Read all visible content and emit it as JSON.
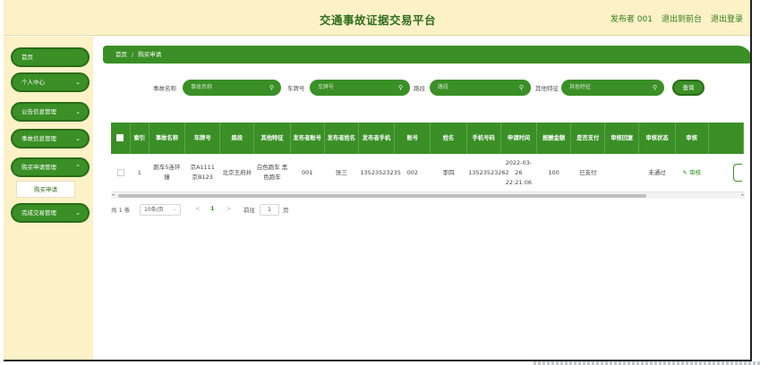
{
  "header": {
    "title": "交通事故证据交易平台",
    "user": "发布者 001",
    "exit_front": "退出到前台",
    "logout": "退出登录"
  },
  "sidebar": {
    "items": [
      {
        "label": "首页",
        "has_chevron": false
      },
      {
        "label": "个人中心",
        "has_chevron": true
      },
      {
        "label": "公告信息管理",
        "has_chevron": true
      },
      {
        "label": "事故信息管理",
        "has_chevron": true
      },
      {
        "label": "购买申请管理",
        "has_chevron": true
      },
      {
        "label": "完成交易管理",
        "has_chevron": true
      }
    ],
    "submenu_active": "购买申请",
    "chevron_icon": "chevron-down-icon"
  },
  "breadcrumb": {
    "home": "首页",
    "separator": "/",
    "current": "购买申请"
  },
  "search": {
    "fields": [
      {
        "label": "事故名称",
        "placeholder": "事故名称"
      },
      {
        "label": "车牌号",
        "placeholder": "车牌号"
      },
      {
        "label": "路段",
        "placeholder": "路段"
      },
      {
        "label": "其他特征",
        "placeholder": "其他特征"
      }
    ],
    "search_icon": "search-icon",
    "query_button": "查询"
  },
  "table": {
    "headers": [
      "",
      "索引",
      "事故名称",
      "车牌号",
      "路段",
      "其他特征",
      "发布者账号",
      "发布者姓名",
      "发布者手机",
      "账号",
      "姓名",
      "手机号码",
      "申请时间",
      "报酬金额",
      "是否支付",
      "审核回复",
      "审核状态",
      "审核",
      ""
    ],
    "rows": [
      {
        "index": "1",
        "accident_name": "跑车5连环撞",
        "plate": "京A1111 京B123",
        "road": "北京王府井",
        "feature": "白色跑车 黑色跑车",
        "publisher_account": "001",
        "publisher_name": "张三",
        "publisher_phone": "13523523235",
        "account": "002",
        "name": "李四",
        "phone": "13523523262",
        "apply_time": "2022-03-26 22:21:06",
        "amount": "100",
        "paid": "已支付",
        "reply": "",
        "status": "未通过",
        "audit_action": "审核"
      }
    ]
  },
  "pagination": {
    "total": "共 1 条",
    "page_size": "10条/页",
    "prev": "<",
    "current_page": "1",
    "next": ">",
    "goto_label": "前往",
    "goto_value": "1",
    "page_unit": "页"
  },
  "colors": {
    "brand_green": "#3a8f26",
    "cream": "#fcf1c7",
    "title_green": "#2f6e1c"
  }
}
